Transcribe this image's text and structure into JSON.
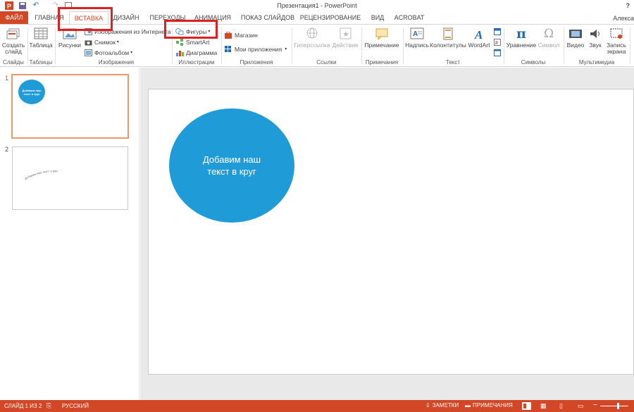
{
  "window": {
    "title": "Презентация1 - PowerPoint",
    "help": "?",
    "user": "Алекса"
  },
  "tabs": [
    "ФАЙЛ",
    "ГЛАВНАЯ",
    "ВСТАВКА",
    "ДИЗАЙН",
    "ПЕРЕХОДЫ",
    "АНИМАЦИЯ",
    "ПОКАЗ СЛАЙДОВ",
    "РЕЦЕНЗИРОВАНИЕ",
    "ВИД",
    "ACROBAT"
  ],
  "ribbon": {
    "slides": {
      "new_slide": "Создать",
      "new_slide2": "слайд",
      "group": "Слайды"
    },
    "tables": {
      "table": "Таблица",
      "group": "Таблицы"
    },
    "images": {
      "pictures": "Рисунки",
      "online": "Изображения из Интернета",
      "screenshot": "Снимок",
      "album": "Фотоальбом",
      "group": "Изображения"
    },
    "illustrations": {
      "shapes": "Фигуры",
      "smartart": "SmartArt",
      "chart": "Диаграмма",
      "group": "Иллюстрации"
    },
    "apps": {
      "store": "Магазин",
      "my_apps": "Мои приложения",
      "group": "Приложения"
    },
    "links": {
      "hyperlink": "Гиперссылка",
      "action": "Действие",
      "group": "Ссылки"
    },
    "comments": {
      "comment": "Примечание",
      "group": "Примечания"
    },
    "text": {
      "textbox": "Надпись",
      "header_footer": "Колонтитулы",
      "wordart": "WordArt",
      "group": "Текст"
    },
    "symbols": {
      "equation": "Уравнение",
      "symbol": "Символ",
      "group": "Символы"
    },
    "media": {
      "video": "Видео",
      "audio": "Звук",
      "record": "Запись",
      "record2": "экрана",
      "group": "Мультимедиа"
    }
  },
  "thumbnails": [
    {
      "num": "1",
      "text": "Добавим наш текст в круг"
    },
    {
      "num": "2",
      "text": "Добавим наш текст в круг"
    }
  ],
  "slide": {
    "circle_text": "Добавим наш текст в круг"
  },
  "status": {
    "slide_info": "СЛАЙД 1 ИЗ 2",
    "language": "РУССКИЙ",
    "notes": "ЗАМЕТКИ",
    "comments": "ПРИМЕЧАНИЯ"
  },
  "colors": {
    "accent": "#d24726",
    "shape_fill": "#1f9bd7",
    "highlight": "#e02020"
  }
}
